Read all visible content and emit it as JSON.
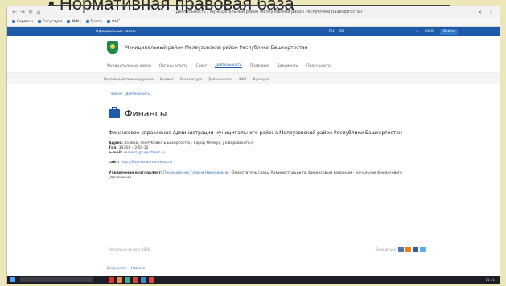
{
  "slide": {
    "bullet": "• Нормативная правовая база"
  },
  "browser": {
    "nav": [
      "←",
      "→",
      "↻",
      "⌂"
    ],
    "tab_title": "Деятельность / Муниципальный район Мелеузовский район Республики Башкортостан",
    "controls": [
      "×",
      "⋮"
    ],
    "bookmarks": [
      "Сервисы",
      "Госуслуги",
      "МФЦ",
      "Почта",
      "ФНС"
    ]
  },
  "site": {
    "topbar": {
      "left": "Официальные сайты",
      "mid": [
        "RU",
        "EN"
      ],
      "right": [
        "⌕",
        "ООО",
        "Войти"
      ]
    },
    "name": "Муниципальный район Мелеузовский район Республики Башкортостан",
    "main_nav": [
      "Муниципальный район",
      "Органы власти",
      "Совет",
      "Деятельность",
      "Правовые",
      "Документы",
      "Пресс-центр"
    ],
    "sub_nav": [
      "Противодействие коррупции",
      "Бюджет",
      "Архитектура",
      "Деятельность",
      "ЖКХ",
      "Культура"
    ],
    "breadcrumb": [
      "Главная",
      "Деятельность"
    ],
    "page_title": "Финансы",
    "org_name": "Финансовое управление Администрации муниципального района Мелеузовский район Республики Башкортостан",
    "address_label": "Адрес:",
    "address": "453850, Республика Башкортостан, Город Мелеуз, ул.Воровского,4",
    "tel_label": "Тел:",
    "tel": "34764 – 3-50-12",
    "email_label": "e-mail:",
    "email": "meleuz_gfu@ufanet.ru",
    "site_label": "сайт:",
    "site_url": "http://finance.admmeleuz.ru",
    "head_label": "Управление возглавляет:",
    "head_name": "Пономаренко Галина Николаевна",
    "head_role": "– Заместитель главы Администрации по финансовым вопросам – начальник финансового управления",
    "updated": "Актуально на дату 2016",
    "share_label": "Поделиться:",
    "footer_links": [
      "Документы",
      "Новости"
    ]
  },
  "taskbar": {
    "tray": "11:41"
  },
  "colors": {
    "accent": "#1e5aa8",
    "logo": "#1f8a4c",
    "slide_bg": "#ece7b8"
  }
}
